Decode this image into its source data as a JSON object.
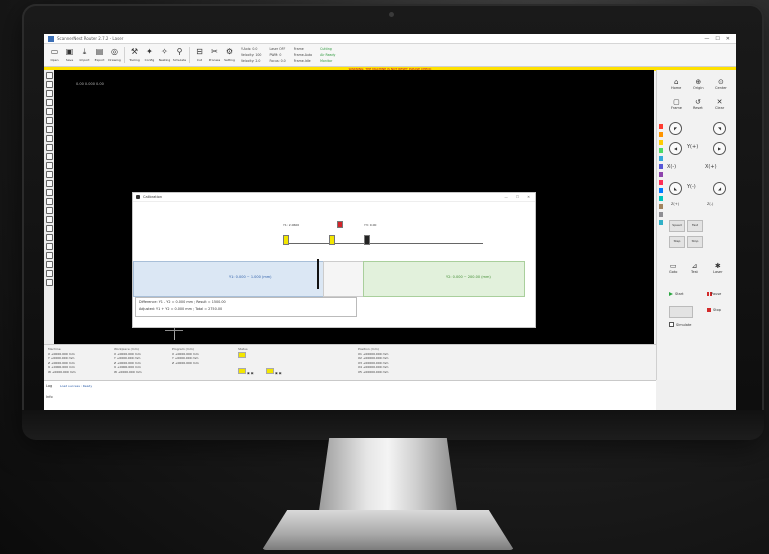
{
  "window": {
    "title": "ScannerNest Router 2.7.2 - Laser",
    "controls": [
      "—",
      "☐",
      "✕"
    ]
  },
  "toolbar": {
    "tools": [
      {
        "label": "Open",
        "icon": "open-icon"
      },
      {
        "label": "Save",
        "icon": "save-icon"
      },
      {
        "label": "Import",
        "icon": "import-icon"
      },
      {
        "label": "Export",
        "icon": "export-icon"
      },
      {
        "label": "Drawing",
        "icon": "drawing-icon"
      },
      {
        "label": "Tooling",
        "icon": "tooling-icon"
      },
      {
        "label": "Config",
        "icon": "config-icon"
      },
      {
        "label": "Nesting",
        "icon": "nesting-icon"
      },
      {
        "label": "Simulate",
        "icon": "simulate-icon"
      },
      {
        "label": "Cut",
        "icon": "cut-icon"
      },
      {
        "label": "Process",
        "icon": "process-icon"
      },
      {
        "label": "Setting",
        "icon": "setting-icon"
      }
    ],
    "status_left": [
      "Y-Axis: 0.0",
      "Velocity: 100",
      "Velocity: 2.0"
    ],
    "status_mid": [
      "Laser OFF",
      "PWM: 0",
      "Focus: 0.0"
    ],
    "status_mid2": [
      "Frame",
      "Frame-Auto",
      "Frame-Idle"
    ],
    "status_right": [
      "Cutting",
      "Air Ready",
      "Monitor"
    ],
    "warning": "WARNING: THE MACHINE IS NOT RESET PLEASE CHECK"
  },
  "canvas": {
    "coord": "0.00  0.000  0.00"
  },
  "dialog": {
    "title": "Calibration",
    "label_left": "Y1: 2.0600",
    "label_mid": "Y2: 0.0",
    "label_right": "Y3: 0.00",
    "zone_left": "Y1: 0.000 ~ 1.000 (mm)",
    "zone_right": "Y2: 0.000 ~ 200.00 (mm)",
    "info_line1": "Difference: Y1 - Y2 = 0.000 mm ; Result = 1500.00",
    "info_line2": "Adjusted: Y1 + Y2 = 0.000 mm ; Total = 2750.00"
  },
  "right_panel": {
    "top_buttons": [
      "Home",
      "Origin",
      "Center",
      "Frame",
      "Reset",
      "Clear"
    ],
    "axis_buttons": [
      "Y(+)",
      "Y(-)",
      "X(+)",
      "X(-)",
      "Z(+)",
      "Z(-)"
    ],
    "panel_buttons": [
      "Speed",
      "Fast",
      "Step",
      "Stop"
    ],
    "mini_buttons": [
      "Goto",
      "Test",
      "Laser"
    ],
    "start_label": "Start",
    "pause_label": "Pause",
    "stop_label": "Stop",
    "checkbox_label": "Simulate",
    "palette": [
      "#ff3b30",
      "#ff9500",
      "#ffcc00",
      "#4cd964",
      "#34aadc",
      "#5856d6",
      "#8e44ad",
      "#ff2d55",
      "#007aff",
      "#00c7be",
      "#a2845e",
      "#8e8e93",
      "#30b0c7"
    ]
  },
  "bottom": {
    "col1_title": "Machine",
    "col1_rows": [
      "X  +0000.000 mm",
      "Y  +0000.000 mm",
      "Z  +0000.000 mm",
      "U  +0000.000 mm",
      "W  +0000.000 mm"
    ],
    "col2_title": "Workpiece (mm)",
    "col2_rows": [
      "X  +0000.000 mm",
      "Y  +0000.000 mm",
      "Z  +0000.000 mm",
      "U  +0000.000 mm",
      "W  +0000.000 mm"
    ],
    "col3_title": "Program (mm)",
    "col3_rows": [
      "X  +0000.000 mm",
      "Y  +0000.000 mm",
      "Z  +0000.000 mm"
    ],
    "col4_title": "Status",
    "col5_title": "Position (mm)",
    "col5_rows": [
      "X1  +00000.000 mm",
      "X2  +00000.000 mm",
      "X3  +00000.000 mm",
      "X4  +00000.000 mm",
      "X5  +00000.000 mm"
    ]
  },
  "console": {
    "label1": "Log",
    "label2": "Info",
    "line": "Load success : Ready"
  }
}
